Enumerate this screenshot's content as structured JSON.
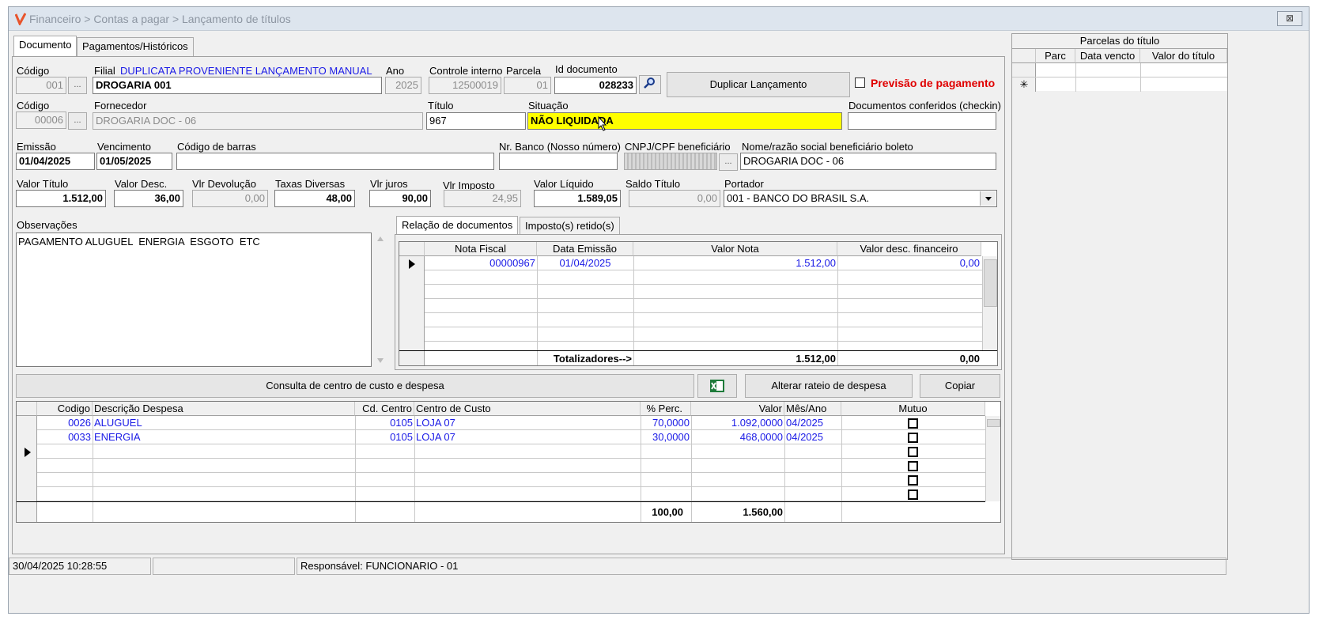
{
  "window": {
    "title": "Financeiro > Contas a pagar > Lançamento de títulos",
    "close": "⊠"
  },
  "tabs": [
    "Documento",
    "Pagamentos/Históricos"
  ],
  "row1": {
    "codigo_label": "Código",
    "codigo": "001",
    "filial_label": "Filial",
    "filial_desc": "DUPLICATA PROVENIENTE LANÇAMENTO MANUAL",
    "filial": "DROGARIA 001",
    "ano_label": "Ano",
    "ano": "2025",
    "controle_label": "Controle interno",
    "controle": "12500019",
    "parcela_label": "Parcela",
    "parcela": "01",
    "iddoc_label": "Id documento",
    "iddoc": "028233",
    "duplicar": "Duplicar Lançamento",
    "previsao": "Previsão de pagamento"
  },
  "row2": {
    "codigo_label": "Código",
    "codigo": "00006",
    "fornecedor_label": "Fornecedor",
    "fornecedor": "DROGARIA DOC - 06",
    "titulo_label": "Título",
    "titulo": "967",
    "situacao_label": "Situação",
    "situacao": "NÃO LIQUIDADA",
    "checkin_label": "Documentos conferidos (checkin)",
    "checkin": ""
  },
  "row3": {
    "emissao_label": "Emissão",
    "emissao": "01/04/2025",
    "vencimento_label": "Vencimento",
    "vencimento": "01/05/2025",
    "barras_label": "Código de barras",
    "barras": "",
    "banco_label": "Nr. Banco (Nosso número)",
    "banco": "",
    "cnpj_label": "CNPJ/CPF beneficiário",
    "nome_label": "Nome/razão social beneficiário boleto",
    "nome": "DROGARIA DOC - 06"
  },
  "row4": {
    "valor_titulo_label": "Valor Título",
    "valor_titulo": "1.512,00",
    "valor_desc_label": "Valor Desc.",
    "valor_desc": "36,00",
    "vlr_dev_label": "Vlr Devolução",
    "vlr_dev": "0,00",
    "taxas_label": "Taxas Diversas",
    "taxas": "48,00",
    "juros_label": "Vlr juros",
    "juros": "90,00",
    "imposto_label": "Vlr Imposto",
    "imposto": "24,95",
    "liquido_label": "Valor Líquido",
    "liquido": "1.589,05",
    "saldo_label": "Saldo Título",
    "saldo": "0,00",
    "portador_label": "Portador",
    "portador": "001 - BANCO DO BRASIL S.A."
  },
  "obs": {
    "label": "Observações",
    "text": "PAGAMENTO ALUGUEL  ENERGIA  ESGOTO  ETC"
  },
  "doc_tabs": [
    "Relação de documentos",
    "Imposto(s) retido(s)"
  ],
  "docs": {
    "headers": [
      "Nota Fiscal",
      "Data Emissão",
      "Valor Nota",
      "Valor desc. financeiro"
    ],
    "rows": [
      [
        "00000967",
        "01/04/2025",
        "1.512,00",
        "0,00"
      ]
    ],
    "total_label": "Totalizadores-->",
    "total_nota": "1.512,00",
    "total_desc": "0,00"
  },
  "buttons": {
    "consulta": "Consulta de centro de custo e despesa",
    "alterar": "Alterar rateio de despesa",
    "copiar": "Copiar"
  },
  "despesas": {
    "headers": [
      "Codigo",
      "Descrição Despesa",
      "Cd. Centro",
      "Centro de Custo",
      "% Perc.",
      "Valor",
      "Mês/Ano",
      "Mutuo"
    ],
    "rows": [
      [
        "0026",
        "ALUGUEL",
        "0105",
        "LOJA 07",
        "70,0000",
        "1.092,0000",
        "04/2025"
      ],
      [
        "0033",
        "ENERGIA",
        "0105",
        "LOJA 07",
        "30,0000",
        "468,0000",
        "04/2025"
      ]
    ],
    "total_perc": "100,00",
    "total_valor": "1.560,00"
  },
  "parcelas": {
    "title": "Parcelas do título",
    "headers": [
      "Parc",
      "Data vencto",
      "Valor do título"
    ],
    "new_row": "✳"
  },
  "status": {
    "datetime": "30/04/2025 10:28:55",
    "empty": "",
    "responsavel": "Responsável: FUNCIONARIO - 01"
  },
  "colors": {
    "accent_blue": "#1a1ae6",
    "previsao_red": "#e00000",
    "situacao_bg": "#ffff00"
  }
}
